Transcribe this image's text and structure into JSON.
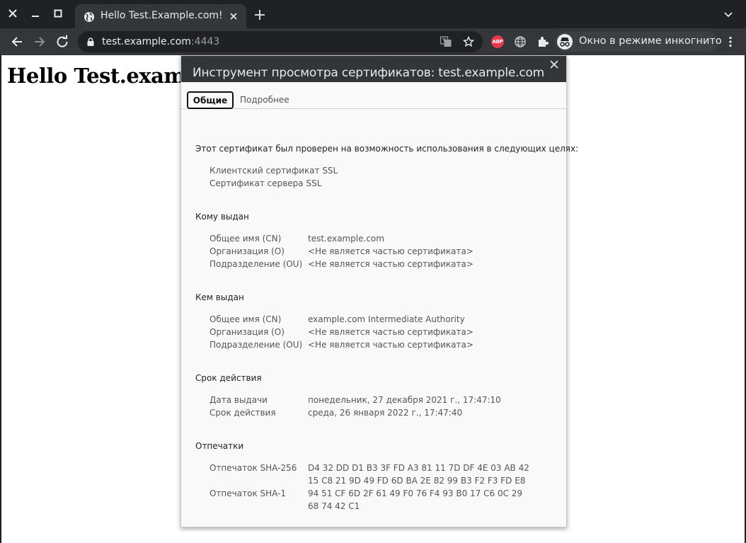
{
  "browser": {
    "tab_title": "Hello Test.Example.com!",
    "url_host": "test.example.com",
    "url_port": ":4443",
    "abp_label": "ABP",
    "incognito_label": "Окно в режиме инкогнито"
  },
  "page": {
    "heading": "Hello Test.example.com!"
  },
  "dialog": {
    "title": "Инструмент просмотра сертификатов: test.example.com",
    "tabs": [
      {
        "label": "Общие",
        "active": true
      },
      {
        "label": "Подробнее",
        "active": false
      }
    ],
    "intro": "Этот сертификат был проверен на возможность использования в следующих целях:",
    "purposes": [
      "Клиентский сертификат SSL",
      "Сертификат сервера SSL"
    ],
    "issued_to": {
      "title": "Кому выдан",
      "rows": [
        {
          "label": "Общее имя (CN)",
          "value": "test.example.com"
        },
        {
          "label": "Организация (O)",
          "value": "<Не является частью сертификата>"
        },
        {
          "label": "Подразделение (OU)",
          "value": "<Не является частью сертификата>"
        }
      ]
    },
    "issued_by": {
      "title": "Кем выдан",
      "rows": [
        {
          "label": "Общее имя (CN)",
          "value": "example.com Intermediate Authority"
        },
        {
          "label": "Организация (O)",
          "value": "<Не является частью сертификата>"
        },
        {
          "label": "Подразделение (OU)",
          "value": "<Не является частью сертификата>"
        }
      ]
    },
    "validity": {
      "title": "Срок действия",
      "rows": [
        {
          "label": "Дата выдачи",
          "value": "понедельник, 27 декабря 2021 г., 17:47:10"
        },
        {
          "label": "Срок действия",
          "value": "среда, 26 января 2022 г., 17:47:40"
        }
      ]
    },
    "fingerprints": {
      "title": "Отпечатки",
      "rows": [
        {
          "label": "Отпечаток SHA-256",
          "value_line1": "D4 32 DD D1 B3 3F FD A3 81 11 7D DF 4E 03 AB 42",
          "value_line2": "15 C8 21 9D 49 FD 6D BA 2E 82 99 B3 F2 F3 FD E8"
        },
        {
          "label": "Отпечаток SHA-1",
          "value_line1": "94 51 CF 6D 2F 61 49 F0 76 F4 93 B0 17 C6 0C 29",
          "value_line2": "68 74 42 C1"
        }
      ]
    }
  }
}
